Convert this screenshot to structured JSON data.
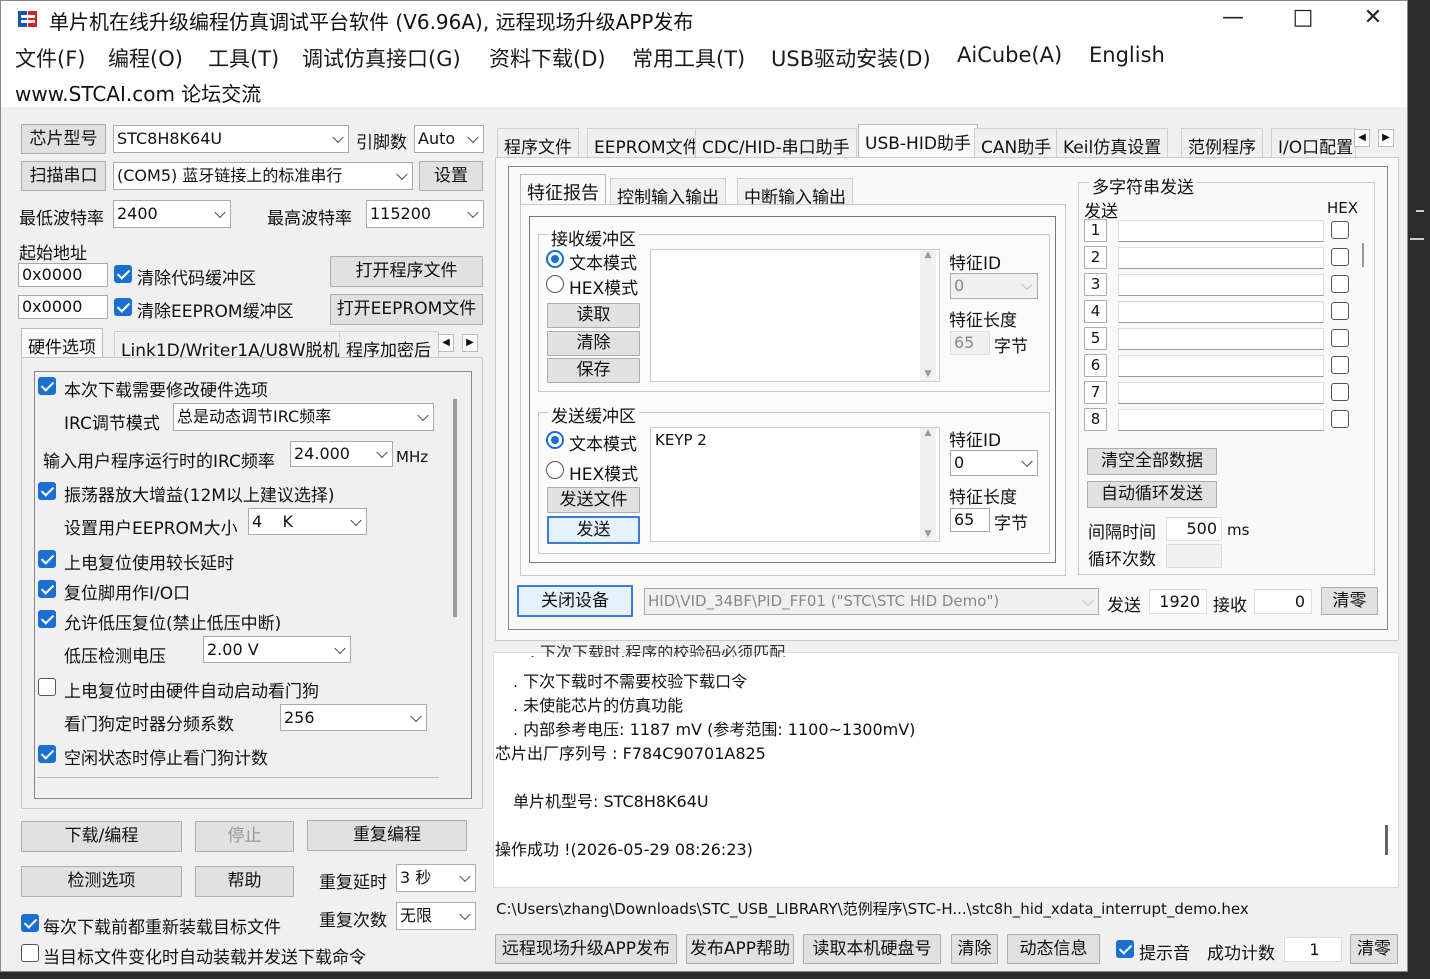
{
  "title": "单片机在线升级编程仿真调试平台软件 (V6.96A), 远程现场升级APP发布",
  "menu": [
    "文件(F)",
    "编程(O)",
    "工具(T)",
    "调试仿真接口(G)",
    "资料下载(D)",
    "常用工具(T)",
    "USB驱动安装(D)",
    "AiCube(A)",
    "English"
  ],
  "menu_link": "www.STCAI.com 论坛交流",
  "left": {
    "chip_label": "芯片型号",
    "chip_value": "STC8H8K64U",
    "pins_label": "引脚数",
    "pins_value": "Auto",
    "scan_btn": "扫描串口",
    "port_value": "(COM5) 蓝牙链接上的标准串行",
    "settings_btn": "设置",
    "min_baud_label": "最低波特率",
    "min_baud": "2400",
    "max_baud_label": "最高波特率",
    "max_baud": "115200",
    "start_addr_label": "起始地址",
    "addr1": "0x0000",
    "clear_code": "清除代码缓冲区",
    "open_prog": "打开程序文件",
    "addr2": "0x0000",
    "clear_eeprom": "清除EEPROM缓冲区",
    "open_eeprom": "打开EEPROM文件",
    "tabs": [
      "硬件选项",
      "Link1D/Writer1A/U8W脱机",
      "程序加密后"
    ],
    "opt_modify_hw": "本次下载需要修改硬件选项",
    "irc_mode_label": "IRC调节模式",
    "irc_mode": "总是动态调节IRC频率",
    "irc_freq_label": "输入用户程序运行时的IRC频率",
    "irc_freq": "24.000",
    "irc_unit": "MHz",
    "opt_osc_gain": "振荡器放大增益(12M以上建议选择)",
    "eeprom_size_label": "设置用户EEPROM大小",
    "eeprom_size": "4    K",
    "opt_long_delay": "上电复位使用较长延时",
    "opt_reset_io": "复位脚用作I/O口",
    "opt_lvd": "允许低压复位(禁止低压中断)",
    "lvd_label": "低压检测电压",
    "lvd_value": "2.00 V",
    "opt_wdt": "上电复位时由硬件自动启动看门狗",
    "wdt_div_label": "看门狗定时器分频系数",
    "wdt_div": "256",
    "opt_idle_wdt": "空闲状态时停止看门狗计数",
    "download_btn": "下载/编程",
    "stop_btn": "停止",
    "reprogram_btn": "重复编程",
    "check_btn": "检测选项",
    "help_btn": "帮助",
    "repeat_delay_label": "重复延时",
    "repeat_delay": "3 秒",
    "repeat_count_label": "重复次数",
    "repeat_count": "无限",
    "opt_reload": "每次下载前都重新装载目标文件",
    "opt_auto_send": "当目标文件变化时自动装载并发送下载命令"
  },
  "right": {
    "tabs": [
      "程序文件",
      "EEPROM文件",
      "CDC/HID-串口助手",
      "USB-HID助手",
      "CAN助手",
      "Keil仿真设置",
      "范例程序",
      "I/O口配置"
    ],
    "subtabs": [
      "特征报告",
      "控制输入输出",
      "中断输入输出"
    ],
    "recv_group": "接收缓冲区",
    "text_mode": "文本模式",
    "hex_mode": "HEX模式",
    "read_btn": "读取",
    "clear_btn": "清除",
    "save_btn": "保存",
    "feat_id_label": "特征ID",
    "recv_feat_id": "0",
    "feat_len_label": "特征长度",
    "recv_feat_len": "65",
    "bytes_unit": "字节",
    "send_group": "发送缓冲区",
    "send_content": "KEYP 2",
    "send_file_btn": "发送文件",
    "send_btn": "发送",
    "send_feat_id": "0",
    "send_feat_len": "65",
    "multi_title": "多字符串发送",
    "multi_send_label": "发送",
    "hex_label": "HEX",
    "rows": [
      "1",
      "2",
      "3",
      "4",
      "5",
      "6",
      "7",
      "8"
    ],
    "clear_all_btn": "清空全部数据",
    "auto_loop_btn": "自动循环发送",
    "interval_label": "间隔时间",
    "interval": "500",
    "interval_unit": "ms",
    "loop_count_label": "循环次数",
    "close_dev_btn": "关闭设备",
    "device": "HID\\VID_34BF\\PID_FF01 (\"STC\\STC HID Demo\")",
    "sent_label": "发送",
    "sent": "1920",
    "recv_label": "接收",
    "recv": "0",
    "clear_count_btn": "清零"
  },
  "log": {
    "lines": [
      ". 下次下载时不需要校验下载口令",
      ". 未使能芯片的仿真功能",
      ". 内部参考电压: 1187 mV (参考范围: 1100~1300mV)",
      "芯片出厂序列号 : F784C90701A825",
      "",
      "单片机型号: STC8H8K64U",
      "",
      "操作成功 !(2026-05-29 08:26:23)"
    ]
  },
  "path": "C:\\Users\\zhang\\Downloads\\STC_USB_LIBRARY\\范例程序\\STC-H...\\stc8h_hid_xdata_interrupt_demo.hex",
  "bottom": {
    "publish_btn": "远程现场升级APP发布",
    "publish_help_btn": "发布APP帮助",
    "read_disk_btn": "读取本机硬盘号",
    "clear_btn": "清除",
    "dynamic_btn": "动态信息",
    "sound": "提示音",
    "success_label": "成功计数",
    "success": "1",
    "zero_btn": "清零"
  }
}
